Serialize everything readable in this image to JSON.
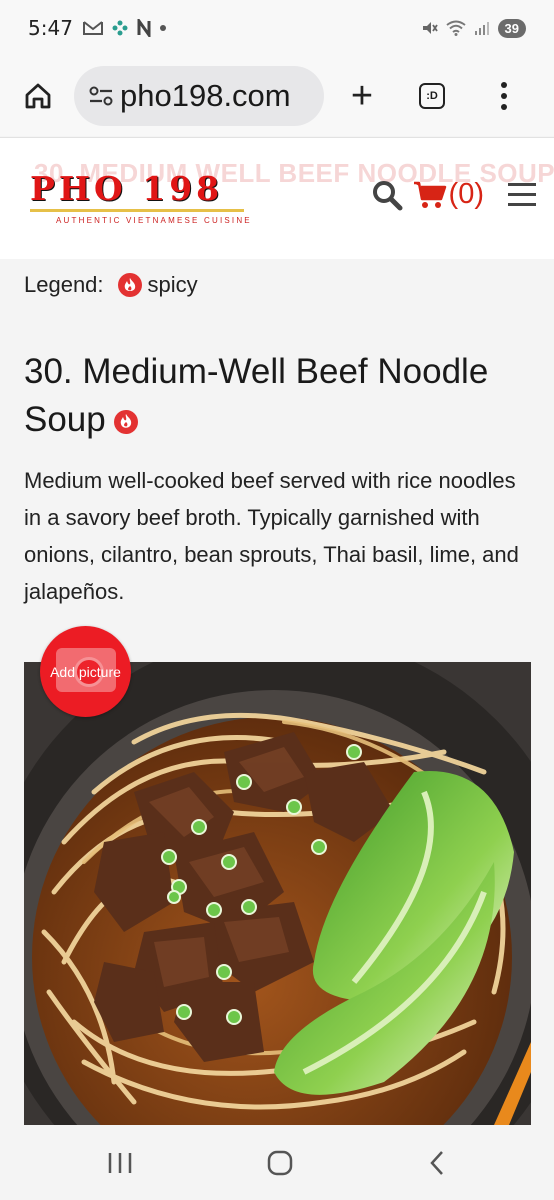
{
  "status_bar": {
    "time": "5:47",
    "left_icons": [
      "gmail-icon",
      "photos-icon",
      "n-icon",
      "dot-icon"
    ],
    "right_icons": [
      "mute-icon",
      "wifi-icon",
      "signal-icon"
    ],
    "battery": "39"
  },
  "browser": {
    "url": "pho198.com",
    "tab_label": ":D"
  },
  "site_header": {
    "logo_text": "PHO 198",
    "logo_tagline": "AUTHENTIC VIETNAMESE CUISINE",
    "ghost_number": "30",
    "ghost_title": "30. MEDIUM WELL BEEF NOODLE SOUP",
    "cart_count": "(0)"
  },
  "legend": {
    "label": "Legend:",
    "spicy_text": "spicy"
  },
  "item": {
    "title": "30. Medium-Well Beef Noodle Soup",
    "description": "Medium well-cooked beef served with rice noodles in a savory beef broth. Typically garnished with onions, cilantro, bean sprouts, Thai basil, lime, and jalapeños.",
    "spicy": true,
    "add_picture_label": "Add picture"
  },
  "colors": {
    "brand_red": "#e01616",
    "cart_red": "#d72415",
    "add_picture_red": "#ec1c24"
  }
}
